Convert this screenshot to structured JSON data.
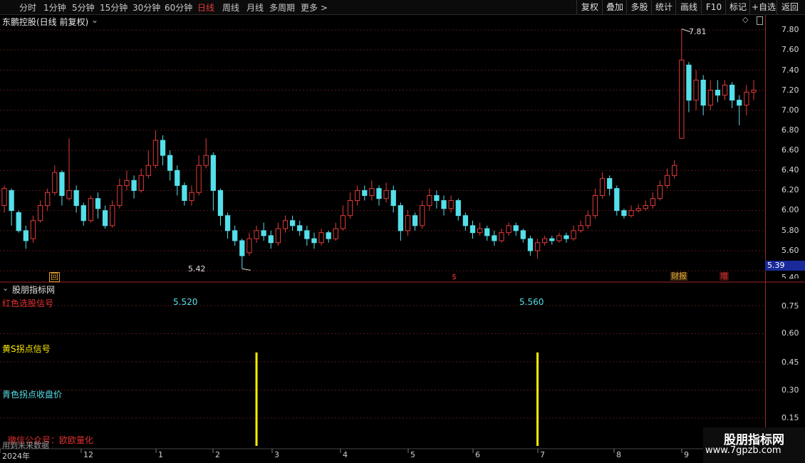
{
  "toolbar": {
    "periods": [
      "分时",
      "1分钟",
      "5分钟",
      "15分钟",
      "30分钟",
      "60分钟",
      "日线",
      "周线",
      "月线",
      "多周期",
      "更多 >"
    ],
    "active_period": "日线",
    "tools": [
      "复权",
      "叠加",
      "多股",
      "统计",
      "画线",
      "F10",
      "标记",
      "+自选",
      "返回"
    ]
  },
  "main_panel": {
    "title": "东鹏控股(日线 前复权)",
    "high_label": "7.81",
    "low_label": "5.42",
    "current_price": "5.39",
    "price_ticks": [
      "7.80",
      "7.60",
      "7.40",
      "7.20",
      "7.00",
      "6.80",
      "6.60",
      "6.40",
      "6.20",
      "6.00",
      "5.80",
      "5.60",
      "5.40"
    ],
    "markers": [
      {
        "text": "回",
        "color": "#e0a030"
      },
      {
        "text": "$",
        "color": "#e03030"
      },
      {
        "text": "财报",
        "color": "#e0a030"
      },
      {
        "text": "增",
        "color": "#e03030"
      }
    ]
  },
  "indicator_panel": {
    "title": "股朋指标网",
    "label_red": "红色选股信号",
    "label_yellow": "黄S拐点信号",
    "label_cyan": "青色拐点收盘价",
    "label_wechat": "微信公众号：欧欧量化",
    "label_bottom": "用到未来数据",
    "value_1": "5.520",
    "value_2": "5.560",
    "ticks": [
      "0.75",
      "0.60",
      "0.45",
      "0.30",
      "0.15"
    ]
  },
  "date_axis": [
    "2024年",
    "12",
    "1",
    "2",
    "3",
    "4",
    "5",
    "6",
    "7",
    "8",
    "9"
  ],
  "watermark": {
    "title": "股朋指标网",
    "url": "www.7gpzb.com"
  },
  "colors": {
    "up": "#e23b3b",
    "down": "#54e0ea",
    "grid": "#5a1616",
    "axis": "#a0262b",
    "signal": "#ffee00"
  },
  "chart_data": {
    "type": "candlestick",
    "ylim": [
      5.4,
      7.9
    ],
    "candles": [
      [
        6.05,
        6.22,
        6.25,
        5.98
      ],
      [
        6.2,
        6.0,
        6.22,
        5.85
      ],
      [
        5.98,
        5.8,
        6.0,
        5.78
      ],
      [
        5.8,
        5.7,
        5.85,
        5.62
      ],
      [
        5.72,
        5.9,
        5.95,
        5.68
      ],
      [
        5.9,
        6.05,
        6.1,
        5.88
      ],
      [
        6.05,
        6.18,
        6.22,
        6.0
      ],
      [
        6.18,
        6.38,
        6.45,
        6.15
      ],
      [
        6.38,
        6.15,
        6.4,
        6.05
      ],
      [
        6.12,
        6.2,
        6.72,
        6.1
      ],
      [
        6.2,
        6.05,
        6.25,
        5.98
      ],
      [
        6.05,
        5.9,
        6.08,
        5.85
      ],
      [
        5.9,
        6.12,
        6.15,
        5.88
      ],
      [
        6.12,
        6.02,
        6.18,
        5.92
      ],
      [
        6.0,
        5.85,
        6.05,
        5.82
      ],
      [
        5.85,
        6.05,
        6.1,
        5.83
      ],
      [
        6.05,
        6.25,
        6.32,
        6.02
      ],
      [
        6.25,
        6.3,
        6.4,
        6.2
      ],
      [
        6.3,
        6.2,
        6.35,
        6.12
      ],
      [
        6.2,
        6.35,
        6.42,
        6.18
      ],
      [
        6.35,
        6.45,
        6.6,
        6.32
      ],
      [
        6.45,
        6.7,
        6.8,
        6.42
      ],
      [
        6.7,
        6.55,
        6.75,
        6.45
      ],
      [
        6.55,
        6.4,
        6.6,
        6.3
      ],
      [
        6.4,
        6.25,
        6.45,
        6.15
      ],
      [
        6.25,
        6.1,
        6.28,
        6.05
      ],
      [
        6.1,
        6.18,
        6.25,
        6.05
      ],
      [
        6.18,
        6.45,
        6.55,
        6.15
      ],
      [
        6.45,
        6.55,
        6.72,
        6.42
      ],
      [
        6.55,
        6.2,
        6.58,
        6.0
      ],
      [
        6.2,
        5.95,
        6.22,
        5.85
      ],
      [
        5.95,
        5.8,
        5.98,
        5.72
      ],
      [
        5.8,
        5.7,
        5.85,
        5.65
      ],
      [
        5.7,
        5.55,
        5.72,
        5.42
      ],
      [
        5.58,
        5.72,
        5.78,
        5.55
      ],
      [
        5.72,
        5.8,
        5.85,
        5.68
      ],
      [
        5.8,
        5.75,
        5.88,
        5.7
      ],
      [
        5.75,
        5.68,
        5.8,
        5.62
      ],
      [
        5.68,
        5.82,
        5.88,
        5.65
      ],
      [
        5.82,
        5.9,
        5.95,
        5.78
      ],
      [
        5.9,
        5.85,
        5.95,
        5.8
      ],
      [
        5.85,
        5.8,
        5.9,
        5.75
      ],
      [
        5.8,
        5.72,
        5.85,
        5.65
      ],
      [
        5.72,
        5.68,
        5.78,
        5.62
      ],
      [
        5.68,
        5.78,
        5.82,
        5.65
      ],
      [
        5.78,
        5.72,
        5.8,
        5.68
      ],
      [
        5.72,
        5.82,
        5.88,
        5.7
      ],
      [
        5.82,
        5.95,
        6.05,
        5.8
      ],
      [
        5.95,
        6.1,
        6.18,
        5.92
      ],
      [
        6.1,
        6.2,
        6.25,
        6.05
      ],
      [
        6.2,
        6.15,
        6.25,
        6.1
      ],
      [
        6.15,
        6.22,
        6.3,
        6.1
      ],
      [
        6.22,
        6.12,
        6.25,
        6.05
      ],
      [
        6.12,
        6.2,
        6.28,
        6.08
      ],
      [
        6.2,
        6.05,
        6.25,
        5.98
      ],
      [
        6.05,
        5.8,
        6.08,
        5.7
      ],
      [
        5.8,
        5.95,
        6.0,
        5.75
      ],
      [
        5.95,
        5.85,
        5.98,
        5.8
      ],
      [
        5.85,
        6.05,
        6.1,
        5.82
      ],
      [
        6.05,
        6.15,
        6.22,
        6.0
      ],
      [
        6.15,
        6.1,
        6.2,
        6.02
      ],
      [
        6.1,
        6.02,
        6.15,
        5.95
      ],
      [
        6.02,
        6.1,
        6.15,
        5.98
      ],
      [
        6.1,
        5.95,
        6.12,
        5.9
      ],
      [
        5.95,
        5.85,
        5.98,
        5.8
      ],
      [
        5.85,
        5.78,
        5.9,
        5.72
      ],
      [
        5.78,
        5.82,
        5.88,
        5.75
      ],
      [
        5.82,
        5.75,
        5.85,
        5.7
      ],
      [
        5.75,
        5.7,
        5.8,
        5.65
      ],
      [
        5.7,
        5.78,
        5.82,
        5.68
      ],
      [
        5.78,
        5.85,
        5.88,
        5.75
      ],
      [
        5.85,
        5.8,
        5.88,
        5.75
      ],
      [
        5.8,
        5.72,
        5.82,
        5.68
      ],
      [
        5.72,
        5.6,
        5.75,
        5.55
      ],
      [
        5.6,
        5.68,
        5.72,
        5.52
      ],
      [
        5.68,
        5.72,
        5.75,
        5.65
      ],
      [
        5.72,
        5.7,
        5.75,
        5.66
      ],
      [
        5.7,
        5.75,
        5.78,
        5.68
      ],
      [
        5.75,
        5.72,
        5.78,
        5.68
      ],
      [
        5.72,
        5.8,
        5.85,
        5.7
      ],
      [
        5.8,
        5.85,
        5.9,
        5.78
      ],
      [
        5.85,
        5.95,
        6.0,
        5.82
      ],
      [
        5.95,
        6.15,
        6.22,
        5.92
      ],
      [
        6.15,
        6.32,
        6.38,
        6.12
      ],
      [
        6.32,
        6.22,
        6.35,
        6.15
      ],
      [
        6.22,
        6.0,
        6.25,
        5.95
      ],
      [
        6.0,
        5.95,
        6.02,
        5.92
      ],
      [
        5.95,
        6.0,
        6.05,
        5.93
      ],
      [
        6.0,
        6.02,
        6.06,
        5.98
      ],
      [
        6.02,
        6.05,
        6.1,
        6.0
      ],
      [
        6.05,
        6.12,
        6.18,
        6.02
      ],
      [
        6.12,
        6.25,
        6.3,
        6.1
      ],
      [
        6.25,
        6.35,
        6.42,
        6.22
      ],
      [
        6.35,
        6.45,
        6.5,
        6.32
      ],
      [
        6.72,
        7.5,
        7.81,
        6.72
      ],
      [
        7.45,
        7.1,
        7.48,
        6.98
      ],
      [
        7.1,
        7.3,
        7.4,
        7.0
      ],
      [
        7.3,
        7.05,
        7.35,
        6.95
      ],
      [
        7.05,
        7.2,
        7.3,
        7.0
      ],
      [
        7.2,
        7.15,
        7.3,
        7.08
      ],
      [
        7.15,
        7.25,
        7.3,
        7.1
      ],
      [
        7.25,
        7.1,
        7.28,
        7.02
      ],
      [
        7.1,
        7.05,
        7.15,
        6.85
      ],
      [
        7.05,
        7.18,
        7.25,
        6.95
      ],
      [
        7.18,
        7.2,
        7.3,
        7.1
      ]
    ],
    "signals": [
      {
        "candle_index": 35,
        "value": 0.5,
        "label": "5.520"
      },
      {
        "candle_index": 74,
        "value": 0.5,
        "label": "5.560"
      }
    ],
    "indicator_ylim": [
      0.0,
      0.85
    ]
  }
}
